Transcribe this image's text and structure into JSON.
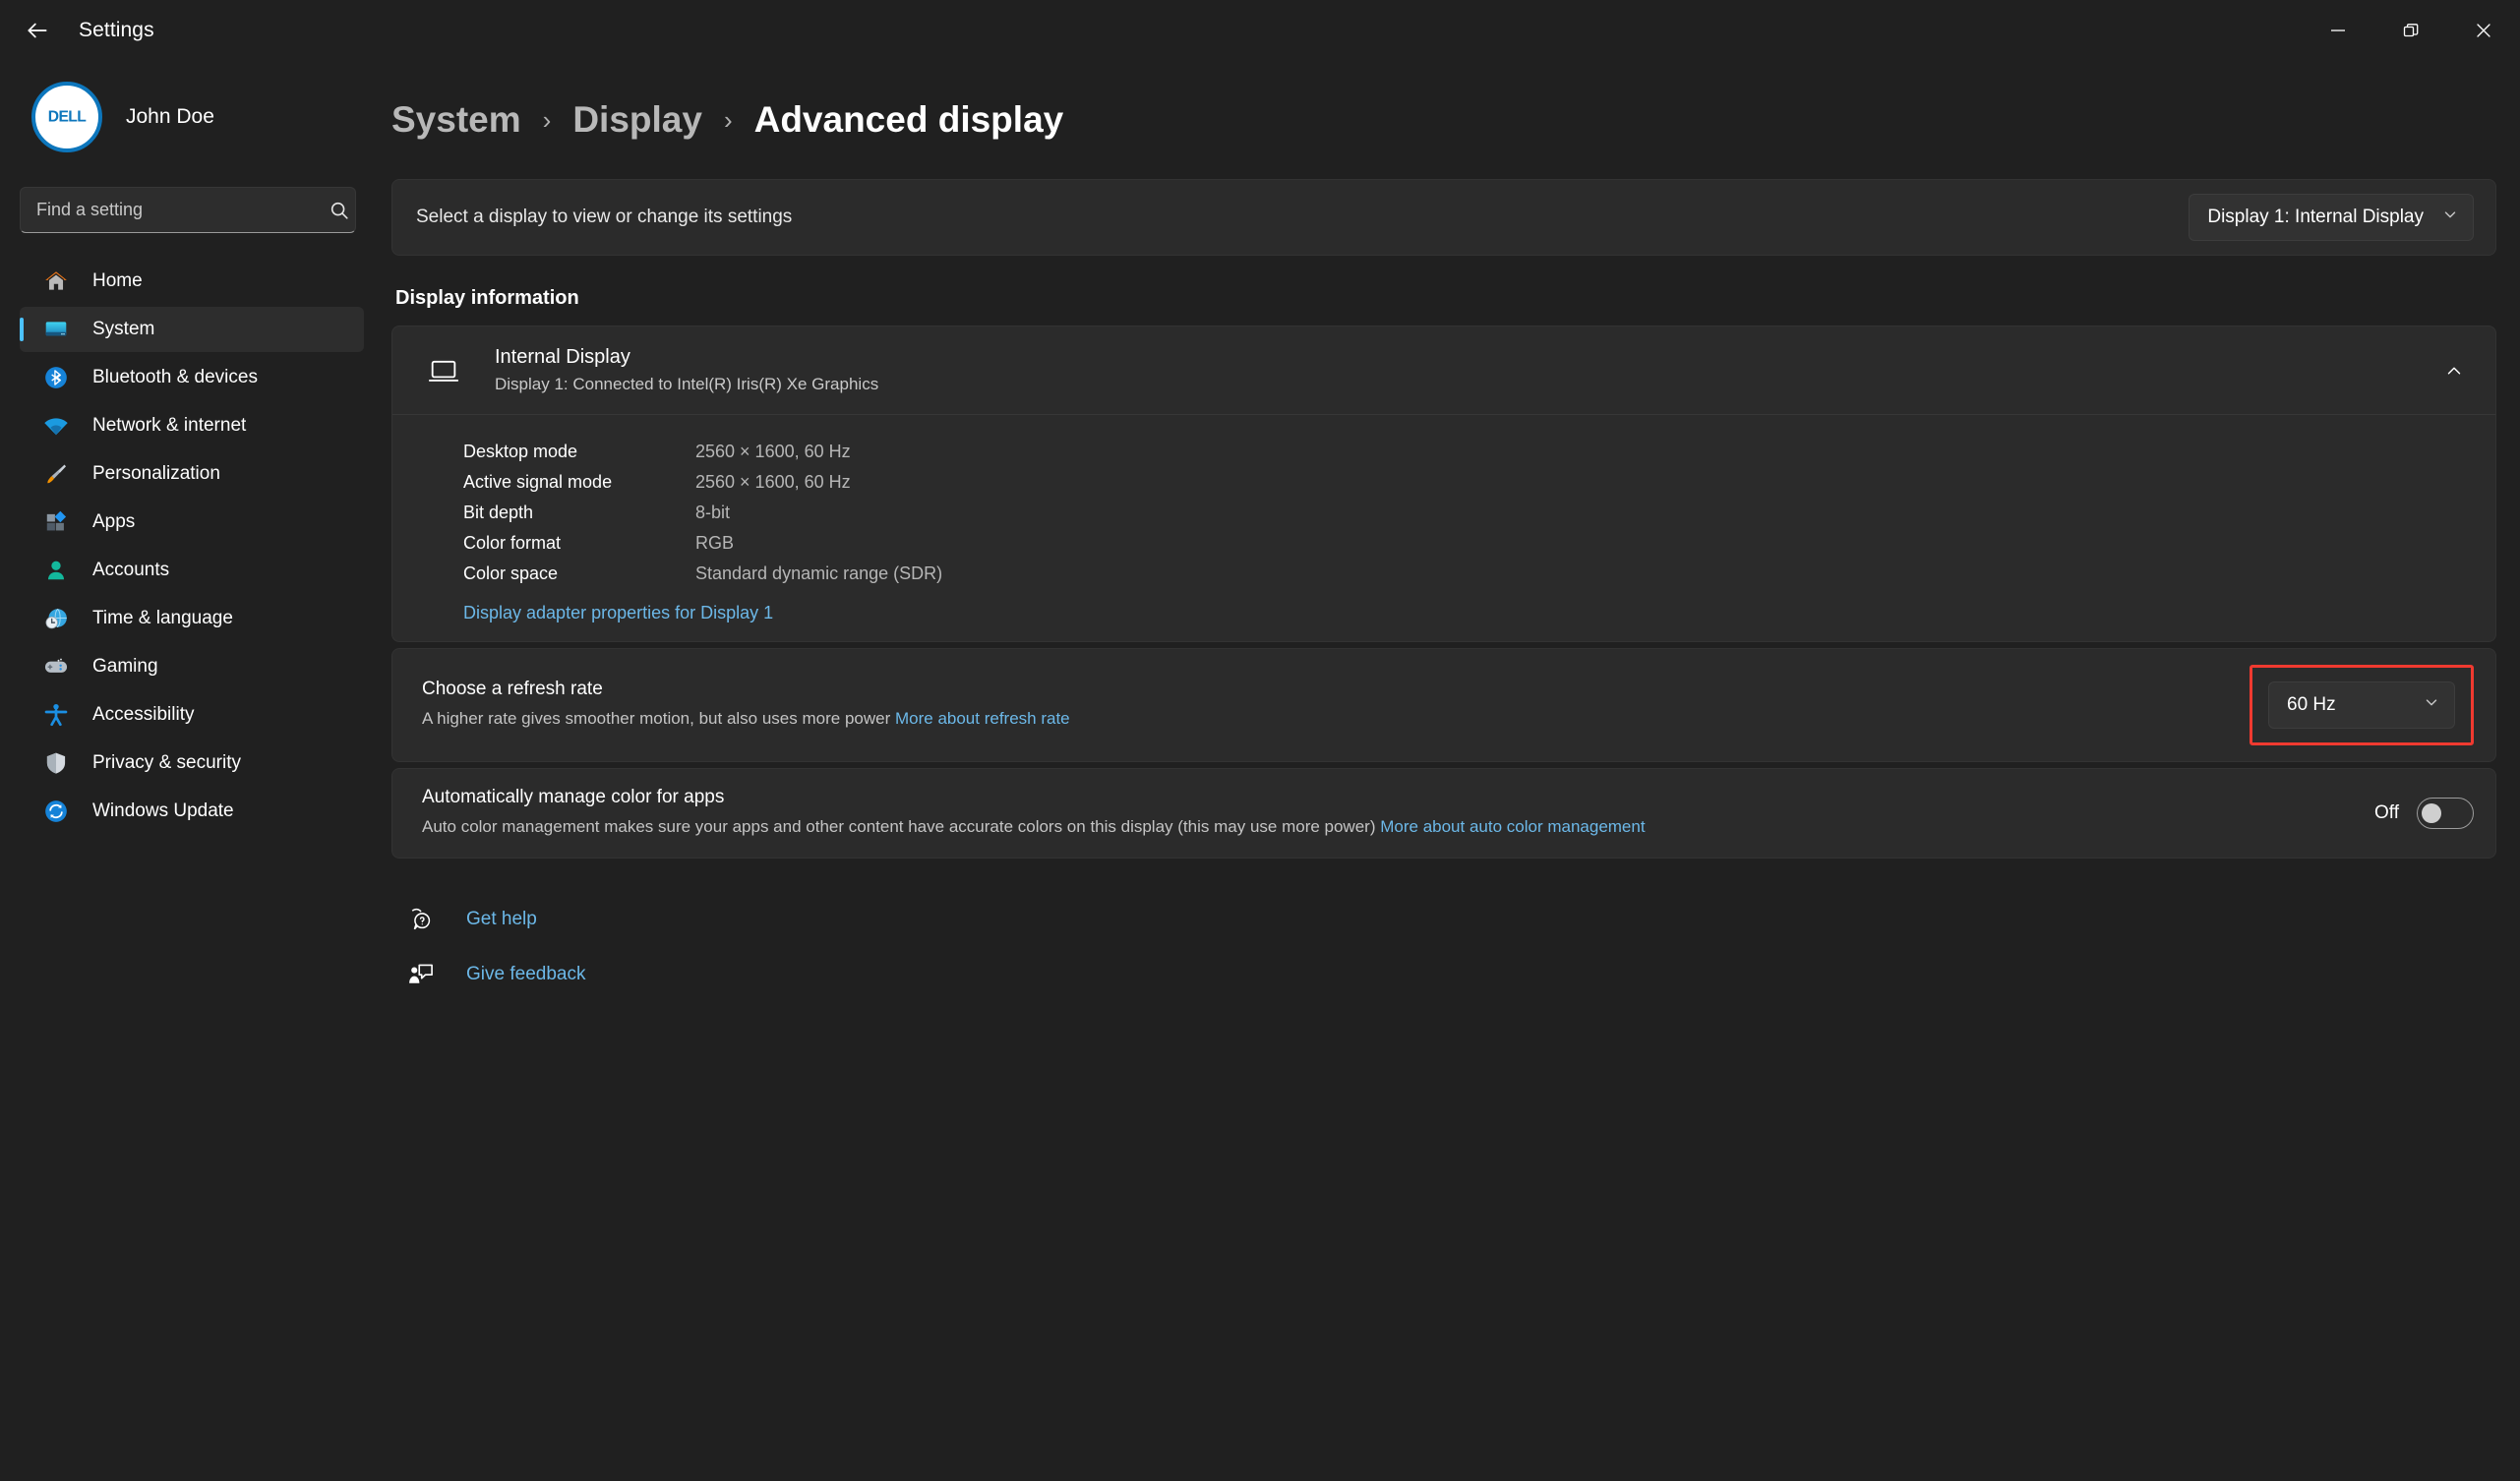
{
  "titlebar": {
    "back_label": "back-arrow",
    "title": "Settings",
    "minimize": "minimize",
    "restore": "restore",
    "close": "close"
  },
  "sidebar": {
    "account_name": "John Doe",
    "avatar_text": "DELL",
    "search": {
      "placeholder": "Find a setting",
      "value": ""
    },
    "items": [
      {
        "label": "Home",
        "icon": "home-icon",
        "selected": false
      },
      {
        "label": "System",
        "icon": "system-icon",
        "selected": true
      },
      {
        "label": "Bluetooth & devices",
        "icon": "bluetooth-icon",
        "selected": false
      },
      {
        "label": "Network & internet",
        "icon": "network-icon",
        "selected": false
      },
      {
        "label": "Personalization",
        "icon": "personalization-icon",
        "selected": false
      },
      {
        "label": "Apps",
        "icon": "apps-icon",
        "selected": false
      },
      {
        "label": "Accounts",
        "icon": "accounts-icon",
        "selected": false
      },
      {
        "label": "Time & language",
        "icon": "time-language-icon",
        "selected": false
      },
      {
        "label": "Gaming",
        "icon": "gaming-icon",
        "selected": false
      },
      {
        "label": "Accessibility",
        "icon": "accessibility-icon",
        "selected": false
      },
      {
        "label": "Privacy & security",
        "icon": "privacy-security-icon",
        "selected": false
      },
      {
        "label": "Windows Update",
        "icon": "windows-update-icon",
        "selected": false
      }
    ]
  },
  "breadcrumb": {
    "level1": "System",
    "level2": "Display",
    "level3": "Advanced display",
    "separator": "›"
  },
  "display_select": {
    "label": "Select a display to view or change its settings",
    "value": "Display 1: Internal Display"
  },
  "display_information": {
    "section_title": "Display information",
    "name": "Internal Display",
    "subtitle": "Display 1: Connected to Intel(R) Iris(R) Xe Graphics",
    "specs": [
      {
        "key": "Desktop mode",
        "value": "2560 × 1600, 60 Hz"
      },
      {
        "key": "Active signal mode",
        "value": "2560 × 1600, 60 Hz"
      },
      {
        "key": "Bit depth",
        "value": "8-bit"
      },
      {
        "key": "Color format",
        "value": "RGB"
      },
      {
        "key": "Color space",
        "value": "Standard dynamic range (SDR)"
      }
    ],
    "adapter_link": "Display adapter properties for Display 1"
  },
  "refresh_rate": {
    "title": "Choose a refresh rate",
    "desc": "A higher rate gives smoother motion, but also uses more power",
    "link": "More about refresh rate",
    "value": "60 Hz",
    "highlight_color": "#f03a30"
  },
  "auto_color": {
    "title": "Automatically manage color for apps",
    "desc": "Auto color management makes sure your apps and other content have accurate colors on this display (this may use more power)",
    "link": "More about auto color management",
    "state": "Off"
  },
  "footer": {
    "get_help": "Get help",
    "give_feedback": "Give feedback"
  },
  "colors": {
    "accent": "#4cc2ff",
    "link": "#6cb8e8",
    "window_bg": "#202020",
    "card_bg": "#2b2b2b",
    "highlight": "#f03a30"
  }
}
